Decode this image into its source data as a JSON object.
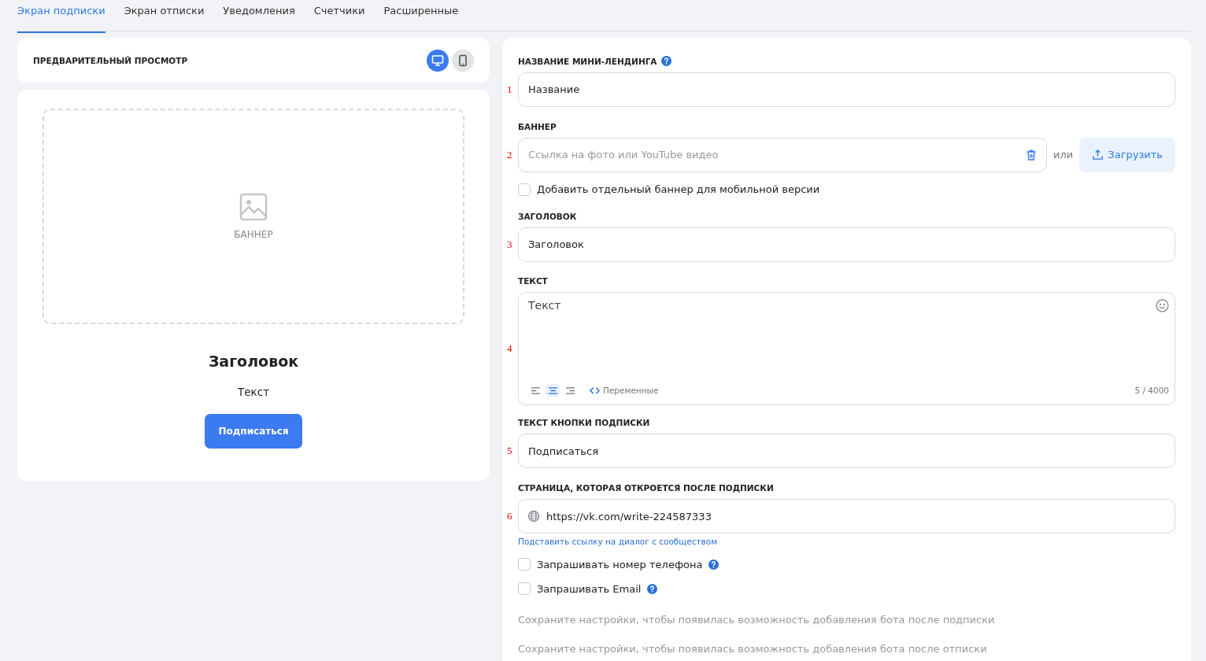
{
  "tabs": [
    {
      "label": "Экран подписки",
      "selected": true
    },
    {
      "label": "Экран отписки",
      "selected": false
    },
    {
      "label": "Уведомления",
      "selected": false
    },
    {
      "label": "Счетчики",
      "selected": false
    },
    {
      "label": "Расширенные",
      "selected": false
    }
  ],
  "preview": {
    "title": "ПРЕДВАРИТЕЛЬНЫЙ ПРОСМОТР",
    "devices": [
      {
        "kind": "desktop",
        "selected": true
      },
      {
        "kind": "mobile",
        "selected": false
      }
    ],
    "banner_label": "БАННЕР",
    "heading": "Заголовок",
    "text": "Текст",
    "button": "Подписаться"
  },
  "form": [
    {
      "kind": "field",
      "label": "НАЗВАНИЕ МИНИ-ЛЕНДИНГА",
      "help": true,
      "marker": "1",
      "value": "Название"
    },
    {
      "kind": "banner",
      "label": "БАННЕР",
      "marker": "2",
      "placeholder": "Ссылка на фото или YouTube видео",
      "or": "или",
      "upload": "Загрузить"
    },
    {
      "kind": "checkbox",
      "label": "Добавить отдельный баннер для мобильной версии",
      "checked": false,
      "help": false
    },
    {
      "kind": "field",
      "label": "ЗАГОЛОВОК",
      "help": false,
      "marker": "3",
      "value": "Заголовок"
    },
    {
      "kind": "textarea",
      "label": "ТЕКСТ",
      "marker": "4",
      "value": "Текст",
      "align": [
        {
          "kind": "left",
          "selected": false
        },
        {
          "kind": "center",
          "selected": true
        },
        {
          "kind": "right",
          "selected": false
        }
      ],
      "variables": "Переменные",
      "counter": "5 / 4000"
    },
    {
      "kind": "field",
      "label": "ТЕКСТ КНОПКИ ПОДПИСКИ",
      "help": false,
      "marker": "5",
      "value": "Подписаться"
    },
    {
      "kind": "url",
      "label": "СТРАНИЦА, КОТОРАЯ ОТКРОЕТСЯ ПОСЛЕ ПОДПИСКИ",
      "marker": "6",
      "value": "https://vk.com/write-224587333",
      "link": "Подставить ссылку на диалог с сообществом"
    },
    {
      "kind": "checkbox",
      "label": "Запрашивать номер телефона",
      "checked": false,
      "help": true
    },
    {
      "kind": "checkbox",
      "label": "Запрашивать Email",
      "checked": false,
      "help": true
    },
    {
      "kind": "note",
      "text": "Сохраните настройки, чтобы появилась возможность добавления бота после подписки"
    },
    {
      "kind": "note",
      "text": "Сохраните настройки, чтобы появилась возможность добавления бота после отписки"
    }
  ]
}
